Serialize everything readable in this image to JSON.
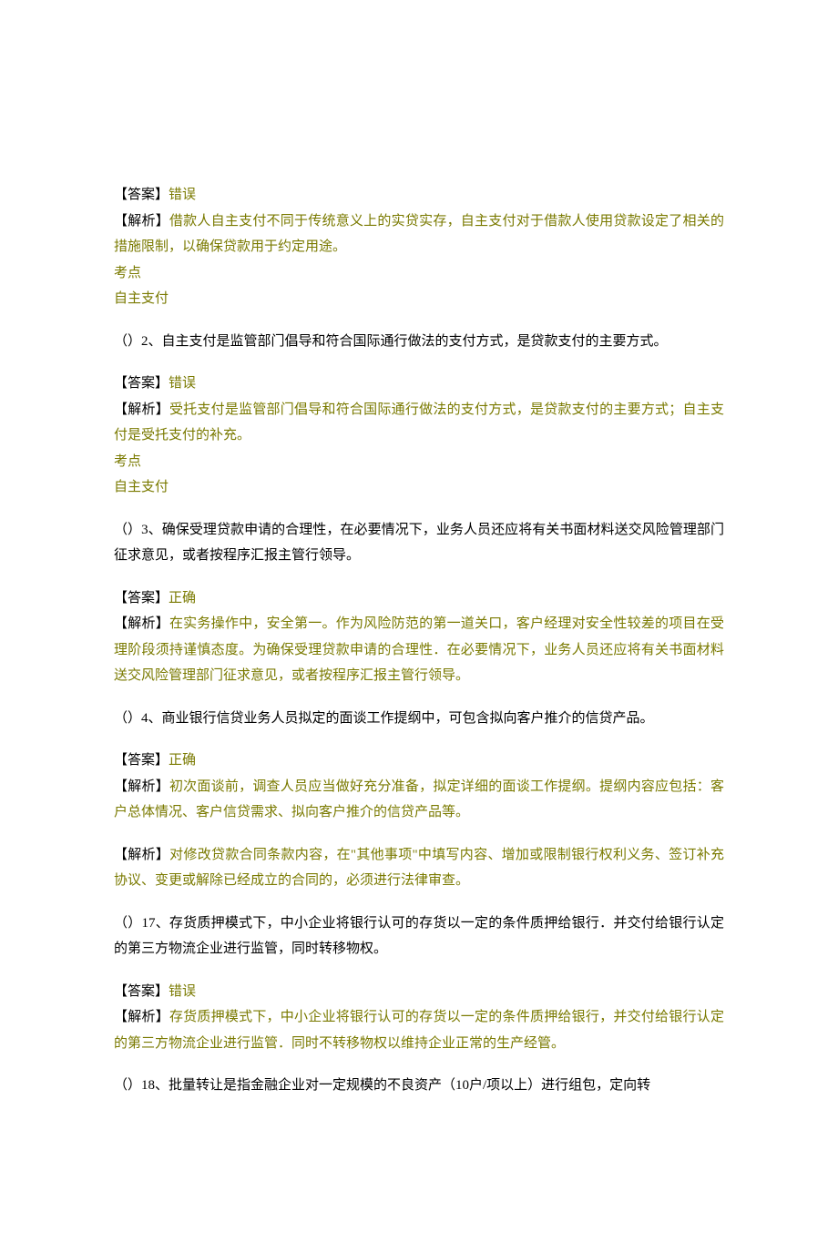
{
  "q1": {
    "answer_label": "【答案】",
    "answer_value": "错误",
    "analysis_label": "【解析】",
    "analysis_text": "借款人自主支付不同于传统意义上的实贷实存，自主支付对于借款人使用贷款设定了相关的措施限制，以确保贷款用于约定用途。",
    "kaodian_label": "考点",
    "kaodian_value": "自主支付"
  },
  "q2": {
    "question": "（）2、自主支付是监管部门倡导和符合国际通行做法的支付方式，是贷款支付的主要方式。",
    "answer_label": "【答案】",
    "answer_value": "错误",
    "analysis_label": "【解析】",
    "analysis_text": "受托支付是监管部门倡导和符合国际通行做法的支付方式，是贷款支付的主要方式；自主支付是受托支付的补充。",
    "kaodian_label": "考点",
    "kaodian_value": "自主支付"
  },
  "q3": {
    "question": "（）3、确保受理贷款申请的合理性，在必要情况下，业务人员还应将有关书面材料送交风险管理部门征求意见，或者按程序汇报主管行领导。",
    "answer_label": "【答案】",
    "answer_value": "正确",
    "analysis_label": "【解析】",
    "analysis_text": "在实务操作中，安全第一。作为风险防范的第一道关口，客户经理对安全性较差的项目在受理阶段须持谨慎态度。为确保受理贷款申请的合理性．在必要情况下，业务人员还应将有关书面材料送交风险管理部门征求意见，或者按程序汇报主管行领导。"
  },
  "q4": {
    "question": "（）4、商业银行信贷业务人员拟定的面谈工作提纲中，可包含拟向客户推介的信贷产品。",
    "answer_label": "【答案】",
    "answer_value": "正确",
    "analysis_label": "【解析】",
    "analysis_text": "初次面谈前，调查人员应当做好充分准备，拟定详细的面谈工作提纲。提纲内容应包括：客户总体情况、客户信贷需求、拟向客户推介的信贷产品等。"
  },
  "q16": {
    "analysis_label": "【解析】",
    "analysis_text": "对修改贷款合同条款内容，在\"其他事项\"中填写内容、增加或限制银行权利义务、签订补充协议、变更或解除已经成立的合同的，必须进行法律审查。"
  },
  "q17": {
    "question": "（）17、存货质押模式下，中小企业将银行认可的存货以一定的条件质押给银行．并交付给银行认定的第三方物流企业进行监管，同时转移物权。",
    "answer_label": "【答案】",
    "answer_value": "错误",
    "analysis_label": "【解析】",
    "analysis_text": "存货质押模式下，中小企业将银行认可的存货以一定的条件质押给银行，并交付给银行认定的第三方物流企业进行监管．同时不转移物权以维持企业正常的生产经管。"
  },
  "q18": {
    "question": "（）18、批量转让是指金融企业对一定规模的不良资产（10户/项以上）进行组包，定向转"
  }
}
